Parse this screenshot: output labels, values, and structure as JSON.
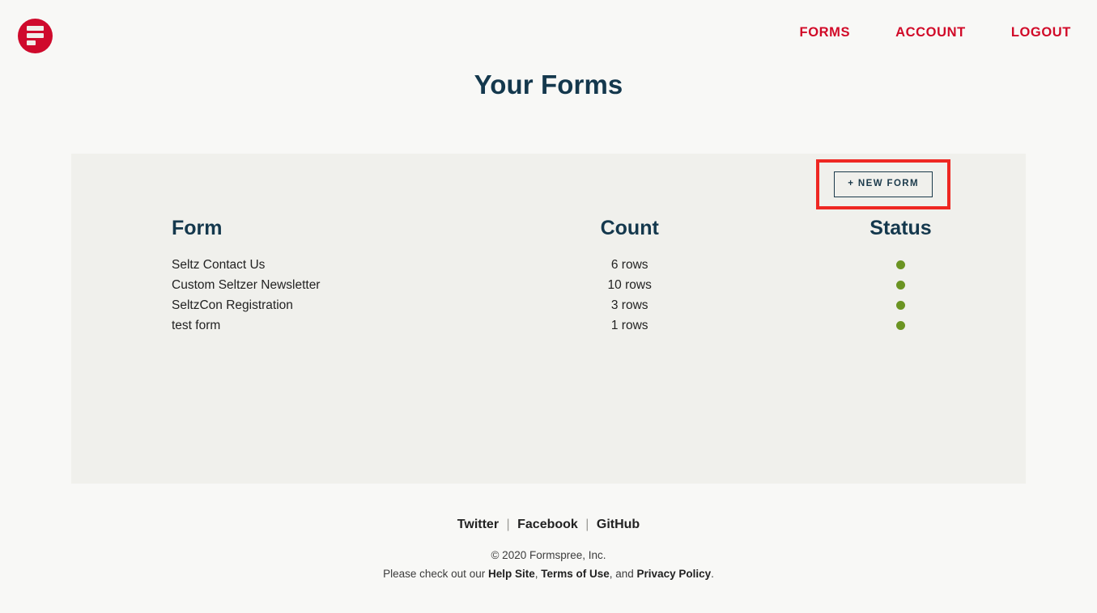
{
  "header": {
    "logo_icon": "formspree-logo-icon",
    "nav": [
      {
        "label": "FORMS"
      },
      {
        "label": "ACCOUNT"
      },
      {
        "label": "LOGOUT"
      }
    ]
  },
  "page": {
    "title": "Your Forms"
  },
  "toolbar": {
    "new_form_label": "+ NEW FORM",
    "highlight_color": "#ee2722"
  },
  "table": {
    "headers": {
      "form": "Form",
      "count": "Count",
      "status": "Status"
    },
    "rows": [
      {
        "name": "Seltz Contact Us",
        "count": "6 rows",
        "status_icon": "status-dot-green"
      },
      {
        "name": "Custom Seltzer Newsletter",
        "count": "10 rows",
        "status_icon": "status-dot-green"
      },
      {
        "name": "SeltzCon Registration",
        "count": "3 rows",
        "status_icon": "status-dot-green"
      },
      {
        "name": "test form",
        "count": "1 rows",
        "status_icon": "status-dot-green"
      }
    ],
    "status_color": "#6b9422"
  },
  "footer": {
    "social": [
      {
        "label": "Twitter"
      },
      {
        "label": "Facebook"
      },
      {
        "label": "GitHub"
      }
    ],
    "separator": "|",
    "copyright": "© 2020 Formspree, Inc.",
    "legal_prefix": "Please check out our ",
    "legal_links": [
      {
        "label": "Help Site"
      },
      {
        "label": "Terms of Use"
      },
      {
        "label": "Privacy Policy"
      }
    ],
    "legal_sep_1": ", ",
    "legal_sep_2": ", and ",
    "legal_suffix": "."
  },
  "theme": {
    "page_bg": "#f8f8f6",
    "panel_bg": "#f0f0ec",
    "brand_red": "#cf0a2c",
    "nav_red": "#d10a28",
    "heading_navy": "#14384d"
  }
}
